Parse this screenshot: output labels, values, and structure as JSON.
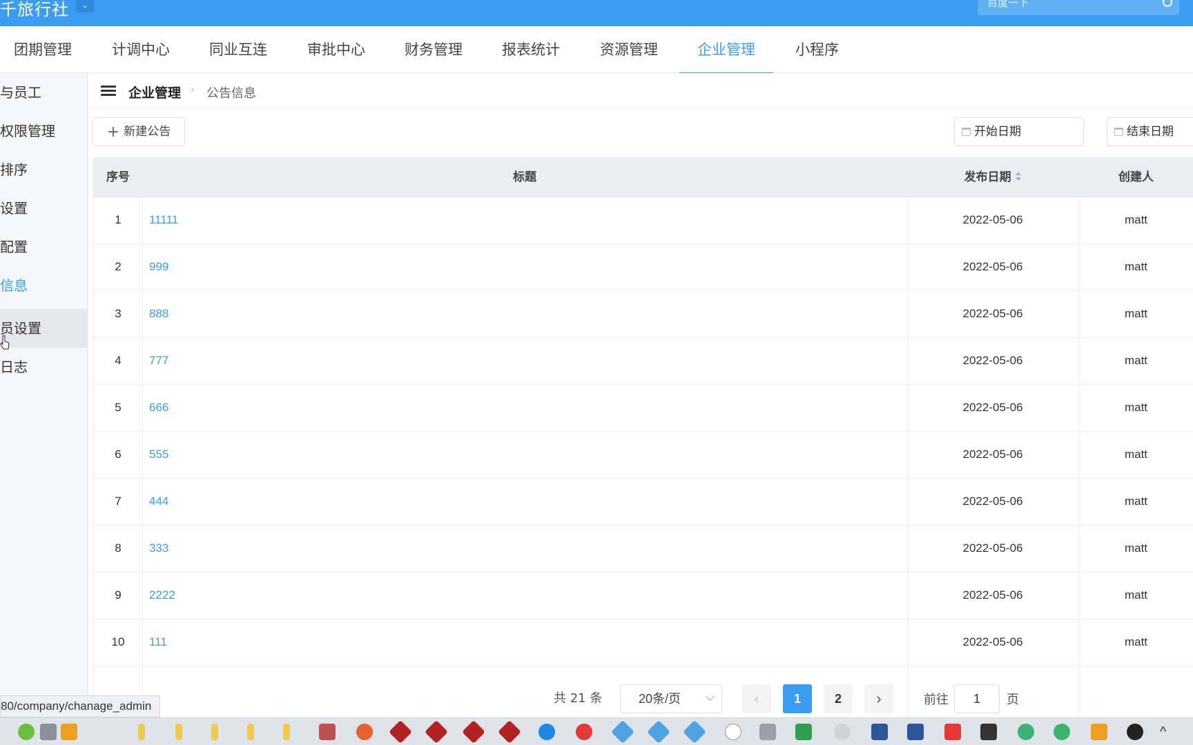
{
  "header": {
    "app_title": "千旅行社",
    "search_placeholder": "百度一下"
  },
  "nav": {
    "tabs": [
      {
        "label": "团期管理"
      },
      {
        "label": "计调中心"
      },
      {
        "label": "同业互连"
      },
      {
        "label": "审批中心"
      },
      {
        "label": "财务管理"
      },
      {
        "label": "报表统计"
      },
      {
        "label": "资源管理"
      },
      {
        "label": "企业管理",
        "active": true
      },
      {
        "label": "小程序"
      }
    ]
  },
  "sidebar": {
    "items": [
      {
        "label": "与员工"
      },
      {
        "label": "权限管理"
      },
      {
        "label": "排序"
      },
      {
        "label": "设置"
      },
      {
        "label": "配置"
      },
      {
        "label": "信息",
        "active": true
      },
      {
        "label": "员设置",
        "hover": true
      },
      {
        "label": "日志"
      }
    ]
  },
  "breadcrumb": {
    "parent": "企业管理",
    "current": "公告信息"
  },
  "toolbar": {
    "new_label": "新建公告",
    "start_date_placeholder": "开始日期",
    "end_date_placeholder": "结束日期"
  },
  "table": {
    "columns": [
      "序号",
      "标题",
      "发布日期",
      "创建人"
    ],
    "rows": [
      {
        "idx": "1",
        "title": "11111",
        "date": "2022-05-06",
        "creator": "matt"
      },
      {
        "idx": "2",
        "title": "999",
        "date": "2022-05-06",
        "creator": "matt"
      },
      {
        "idx": "3",
        "title": "888",
        "date": "2022-05-06",
        "creator": "matt"
      },
      {
        "idx": "4",
        "title": "777",
        "date": "2022-05-06",
        "creator": "matt"
      },
      {
        "idx": "5",
        "title": "666",
        "date": "2022-05-06",
        "creator": "matt"
      },
      {
        "idx": "6",
        "title": "555",
        "date": "2022-05-06",
        "creator": "matt"
      },
      {
        "idx": "7",
        "title": "444",
        "date": "2022-05-06",
        "creator": "matt"
      },
      {
        "idx": "8",
        "title": "333",
        "date": "2022-05-06",
        "creator": "matt"
      },
      {
        "idx": "9",
        "title": "2222",
        "date": "2022-05-06",
        "creator": "matt"
      },
      {
        "idx": "10",
        "title": "111",
        "date": "2022-05-06",
        "creator": "matt"
      }
    ]
  },
  "pagination": {
    "total_text": "共 21 条",
    "page_size": "20条/页",
    "prev_symbol": "‹",
    "next_symbol": "›",
    "pages": [
      "1",
      "2"
    ],
    "current_page": "1",
    "goto_label": "前往",
    "goto_value": "1",
    "goto_unit": "页"
  },
  "status_bar": {
    "url": "80/company/chanage_admin"
  },
  "colors": {
    "primary": "#3a9df0",
    "header_bg": "#3a9df0",
    "table_head_bg": "#e9eef4"
  },
  "taskbar": {
    "icons": [
      "file-explorer-icon",
      "browser-icon",
      "folder-icon",
      "sublime-icon",
      "git-icon",
      "edge-icon",
      "chrome-icon",
      "vscode-icon",
      "wechat-icon",
      "word-icon",
      "excel-icon",
      "terminal-icon",
      "capcut-icon"
    ]
  }
}
